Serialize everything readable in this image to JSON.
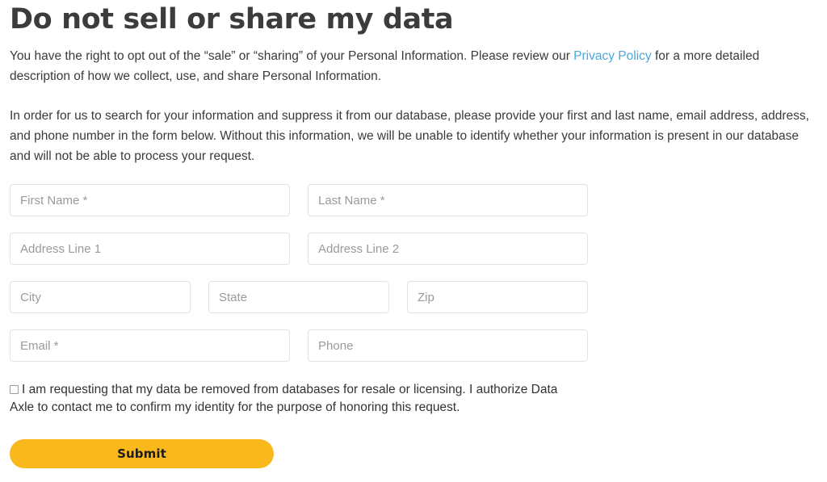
{
  "page": {
    "title": "Do not sell or share my data"
  },
  "intro": {
    "paragraph1_before_link": "You have the right to opt out of the “sale” or “sharing” of your Personal Information. Please review our ",
    "link_label": "Privacy Policy",
    "paragraph1_after_link": " for a more detailed description of how we collect, use, and share Personal Information.",
    "paragraph2": "In order for us to search for your information and suppress it from our database, please provide your first and last name, email address, address, and phone number in the form below. Without this information, we will be unable to identify whether your information is present in our database and will not be able to process your request."
  },
  "form": {
    "first_name": {
      "placeholder": "First Name *",
      "value": ""
    },
    "last_name": {
      "placeholder": "Last Name *",
      "value": ""
    },
    "address_line_1": {
      "placeholder": "Address Line 1",
      "value": ""
    },
    "address_line_2": {
      "placeholder": "Address Line 2",
      "value": ""
    },
    "city": {
      "placeholder": "City",
      "value": ""
    },
    "state": {
      "placeholder": "State",
      "value": ""
    },
    "zip": {
      "placeholder": "Zip",
      "value": ""
    },
    "email": {
      "placeholder": "Email *",
      "value": ""
    },
    "phone": {
      "placeholder": "Phone",
      "value": ""
    },
    "consent_label": "I am requesting that my data be removed from databases for resale or licensing. I authorize Data Axle to contact me to confirm my identity for the purpose of honoring this request.",
    "consent_checked": false,
    "submit_label": "Submit"
  },
  "colors": {
    "heading": "#3c3c3c",
    "body_text": "#333333",
    "link": "#4aa8de",
    "field_border": "#e3e3e3",
    "placeholder": "#9a9a9a",
    "submit_background": "#f9b81c",
    "submit_text": "#1c1c1c",
    "page_background": "#ffffff"
  }
}
